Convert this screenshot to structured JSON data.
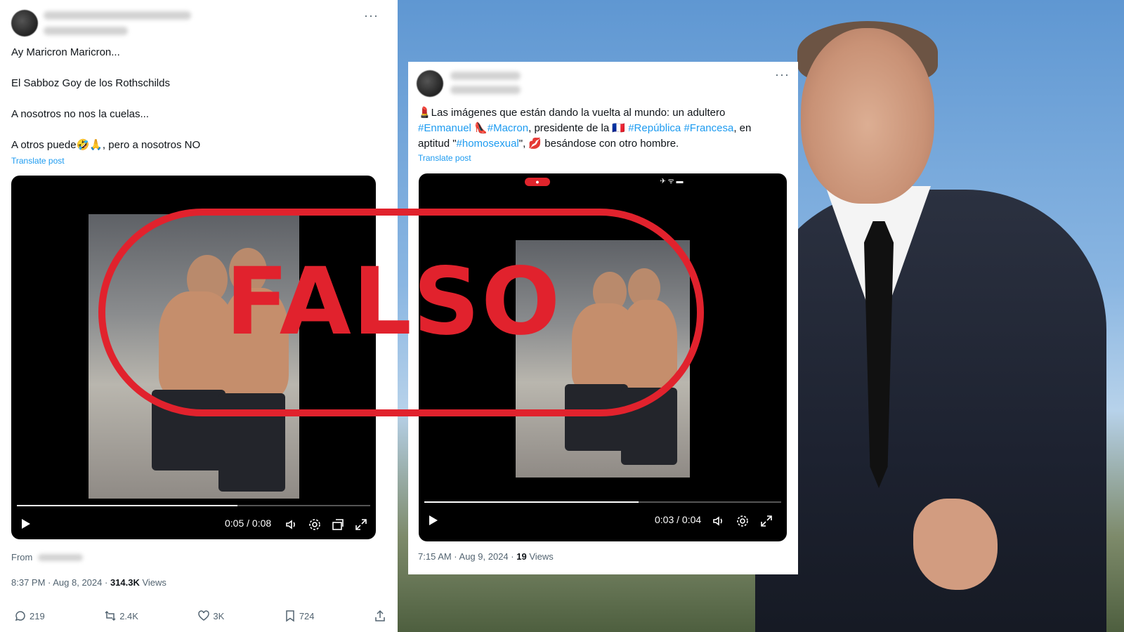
{
  "tweet1": {
    "lines": [
      "Ay Maricron Maricron...",
      "El Sabboz Goy de los Rothschilds",
      "A nosotros no nos la cuelas...",
      "A otros puede🤣🙏, pero a nosotros NO"
    ],
    "translate_label": "Translate post",
    "video": {
      "time": "0:05 / 0:08",
      "progress": 0.625
    },
    "from_label": "From",
    "timestamp": "8:37 PM · Aug 8, 2024 ·",
    "views_count": "314.3K",
    "views_label": "Views",
    "actions": {
      "replies": "219",
      "reposts": "2.4K",
      "likes": "3K",
      "bookmarks": "724"
    }
  },
  "tweet2": {
    "line1": "💄Las imágenes que están dando la vuelta al mundo: un adultero",
    "line2_tag1": "#Enmanuel",
    "line2_emoji": "👠",
    "line2_tag2": "#Macron",
    "line2_text": ", presidente de la 🇫🇷",
    "line2_tag3": "#República",
    "line2_tag4": "#Francesa",
    "line2_end": ", en",
    "line3_start": "aptitud \"",
    "line3_tag": "#homosexual",
    "line3_end": "\", 💋 besándose con otro hombre.",
    "translate_label": "Translate post",
    "video": {
      "time": "0:03 / 0:04",
      "progress": 0.6
    },
    "timestamp": "7:15 AM · Aug 9, 2024 ·",
    "views_count": "19",
    "views_label": "Views"
  },
  "stamp": {
    "text": "FALSO",
    "color": "#e1222d"
  },
  "colors": {
    "link": "#1d9bf0",
    "muted": "#536471"
  }
}
